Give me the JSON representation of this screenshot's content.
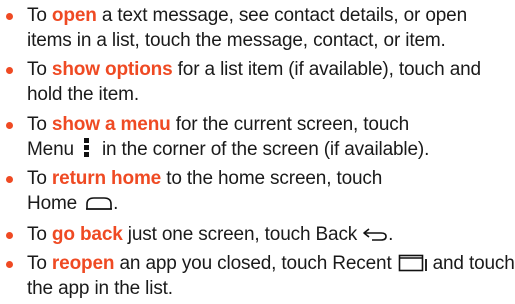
{
  "items": [
    {
      "pre": "To ",
      "keyword": "open",
      "post": " a text message, see contact details, or open items in a list, touch the message, contact, or item."
    },
    {
      "pre": "To ",
      "keyword": "show options",
      "post": " for a list item (if available), touch and hold the item."
    },
    {
      "pre": "To ",
      "keyword": "show a menu",
      "post": " for the current screen, touch",
      "line2_pre": "Menu",
      "icon": "menu-dots-icon",
      "line2_post": "in the corner of the screen (if available)."
    },
    {
      "pre": "To ",
      "keyword": "return home",
      "post": " to the home screen, touch",
      "line2_pre": "Home",
      "icon": "home-icon",
      "line2_post": "."
    },
    {
      "pre": "To ",
      "keyword": "go back",
      "post": " just one screen, touch Back",
      "icon": "back-arrow-icon",
      "post2": "."
    },
    {
      "pre": "To ",
      "keyword": "reopen",
      "post": " an app you closed, touch Recent",
      "icon": "recent-apps-icon",
      "post2": "and touch the app in the list."
    }
  ],
  "colors": {
    "accent": "#ef4a23",
    "text": "#1a1a1a"
  }
}
